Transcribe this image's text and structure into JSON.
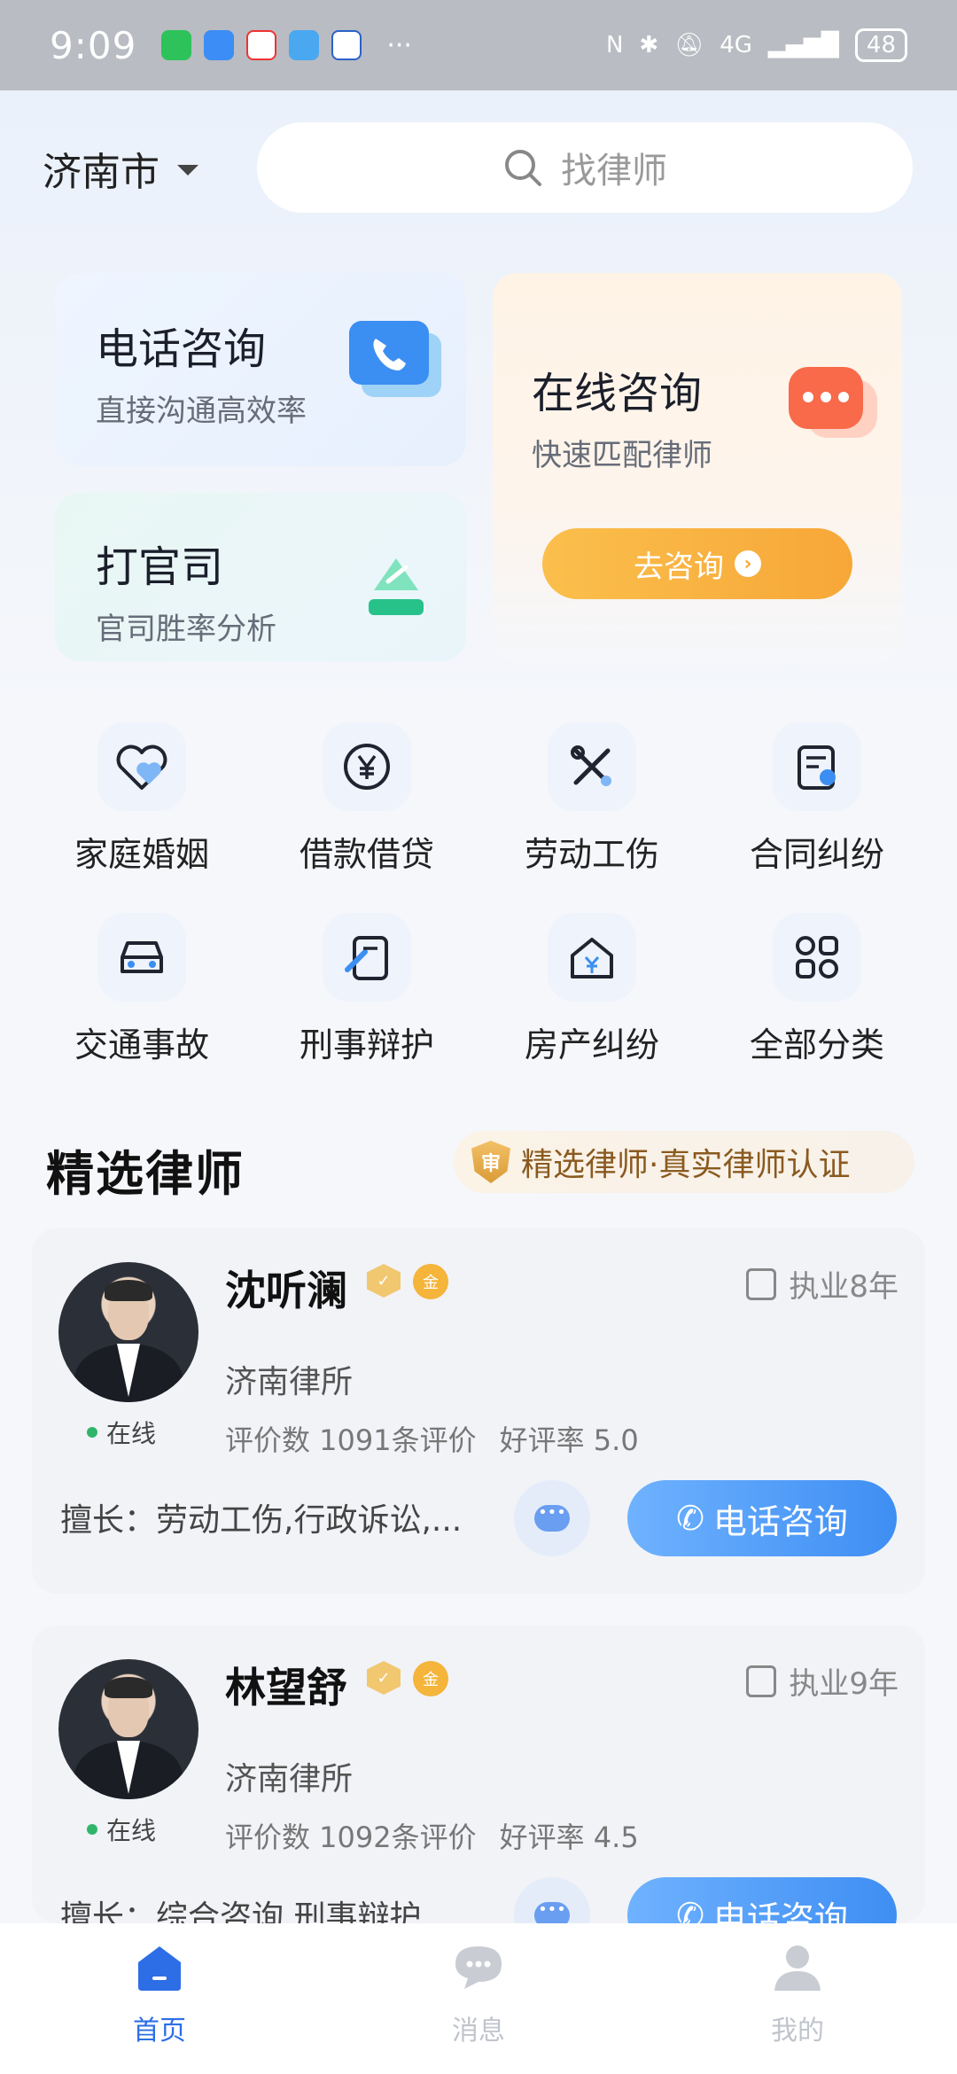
{
  "status_bar": {
    "time": "9:09",
    "battery": "48",
    "network": "4G"
  },
  "header": {
    "city": "济南市",
    "search_placeholder": "找律师"
  },
  "services": {
    "phone": {
      "title": "电话咨询",
      "subtitle": "直接沟通高效率"
    },
    "lawsuit": {
      "title": "打官司",
      "subtitle": "官司胜率分析"
    },
    "online": {
      "title": "在线咨询",
      "subtitle": "快速匹配律师",
      "button": "去咨询"
    }
  },
  "categories": [
    {
      "label": "家庭婚姻",
      "icon": "heart-icon"
    },
    {
      "label": "借款借贷",
      "icon": "yuan-icon"
    },
    {
      "label": "劳动工伤",
      "icon": "tools-icon"
    },
    {
      "label": "合同纠纷",
      "icon": "contract-icon"
    },
    {
      "label": "交通事故",
      "icon": "car-icon"
    },
    {
      "label": "刑事辩护",
      "icon": "gavel-icon"
    },
    {
      "label": "房产纠纷",
      "icon": "house-icon"
    },
    {
      "label": "全部分类",
      "icon": "grid-icon"
    }
  ],
  "section": {
    "title": "精选律师",
    "badge": "精选律师·真实律师认证"
  },
  "lawyers": [
    {
      "name": "沈听澜",
      "years": "执业8年",
      "firm": "济南律所",
      "status": "在线",
      "reviews": "评价数 1091条评价",
      "score": "好评率 5.0",
      "specialty": "擅长：劳动工伤,行政诉讼,...",
      "call": "电话咨询"
    },
    {
      "name": "林望舒",
      "years": "执业9年",
      "firm": "济南律所",
      "status": "在线",
      "reviews": "评价数 1092条评价",
      "score": "好评率 4.5",
      "specialty": "擅长：综合咨询,刑事辩护",
      "call": "电话咨询"
    }
  ],
  "nav": [
    {
      "label": "首页",
      "icon": "home-icon",
      "active": true
    },
    {
      "label": "消息",
      "icon": "message-icon",
      "active": false
    },
    {
      "label": "我的",
      "icon": "profile-icon",
      "active": false
    }
  ],
  "colors": {
    "accent_blue": "#3e8ef3",
    "accent_orange": "#f7a738",
    "online_green": "#2fb56a"
  }
}
